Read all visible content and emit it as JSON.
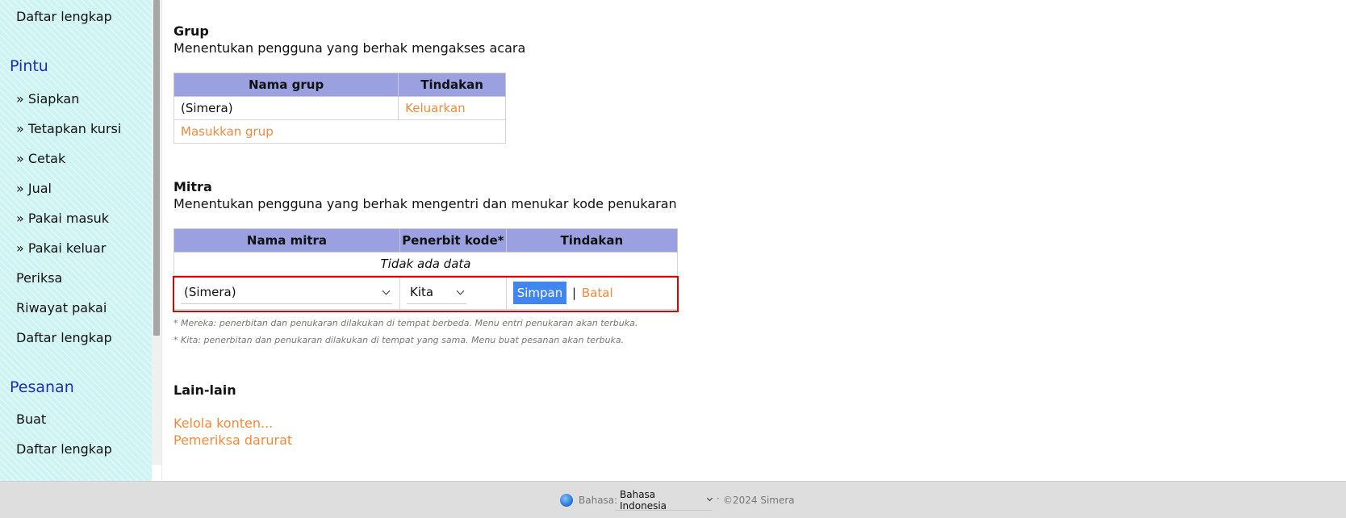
{
  "sidebar": {
    "top_item": "Daftar lengkap",
    "pintu": {
      "heading": "Pintu",
      "items": [
        "» Siapkan",
        "» Tetapkan kursi",
        "» Cetak",
        "» Jual",
        "» Pakai masuk",
        "» Pakai keluar"
      ],
      "plain_items": [
        "Periksa",
        "Riwayat pakai",
        "Daftar lengkap"
      ]
    },
    "pesanan": {
      "heading": "Pesanan",
      "items": [
        "Buat",
        "Daftar lengkap"
      ]
    }
  },
  "grup": {
    "title": "Grup",
    "desc": "Menentukan pengguna yang berhak mengakses acara",
    "headers": [
      "Nama grup",
      "Tindakan"
    ],
    "row": {
      "name": "(Simera)",
      "action": "Keluarkan"
    },
    "add_link": "Masukkan grup"
  },
  "mitra": {
    "title": "Mitra",
    "desc": "Menentukan pengguna yang berhak mengentri dan menukar kode penukaran",
    "headers": [
      "Nama mitra",
      "Penerbit kode*",
      "Tindakan"
    ],
    "empty": "Tidak ada data",
    "edit_row": {
      "name_value": "(Simera)",
      "issuer_value": "Kita",
      "save": "Simpan",
      "separator": "|",
      "cancel": "Batal"
    },
    "notes": [
      "* Mereka: penerbitan dan penukaran dilakukan di tempat berbeda. Menu entri penukaran akan terbuka.",
      "* Kita: penerbitan dan penukaran dilakukan di tempat yang sama. Menu buat pesanan akan terbuka."
    ]
  },
  "lainlain": {
    "title": "Lain-lain",
    "links": [
      "Kelola konten...",
      "Pemeriksa darurat"
    ]
  },
  "footer": {
    "lang_label": "Bahasa:",
    "lang_value": "Bahasa Indonesia",
    "dot": "·",
    "copyright": "©2024 Simera"
  },
  "colors": {
    "header_bg": "#9aa0e0",
    "link": "#f08a3c",
    "save_button": "#3f86f0",
    "highlight": "#e00000",
    "sidebar_heading": "#1f2fb3",
    "sidebar_bg": "#cdf3f3"
  }
}
